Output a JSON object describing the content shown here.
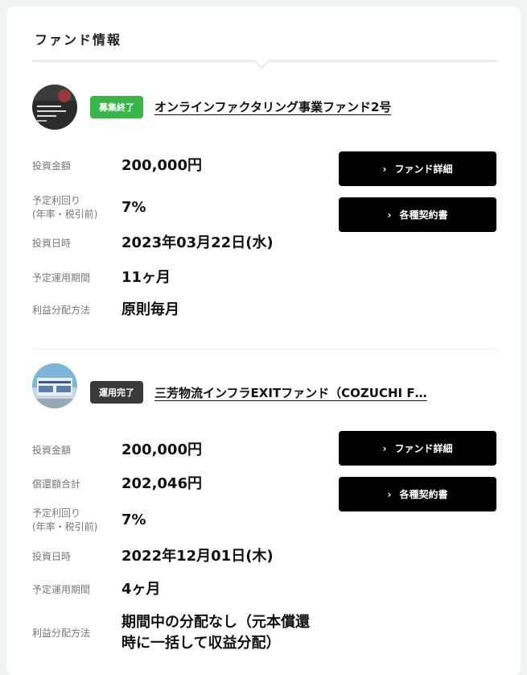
{
  "section_title": "ファンド情報",
  "funds": [
    {
      "status": "募集終了",
      "status_color": "#39b54a",
      "name": "オンラインファクタリング事業ファンド2号",
      "fields": [
        {
          "label": "投資金額",
          "value": "200,000円"
        },
        {
          "label": "予定利回り",
          "label2": "(年率・税引前)",
          "value": "7%"
        },
        {
          "label": "投資日時",
          "value": "2023年03月22日(水)"
        },
        {
          "label": "予定運用期間",
          "value": "11ヶ月"
        },
        {
          "label": "利益分配方法",
          "value": "原則毎月"
        }
      ],
      "buttons": {
        "detail": "ファンド詳細",
        "contracts": "各種契約書"
      }
    },
    {
      "status": "運用完了",
      "status_color": "#3a3a3a",
      "name": "三芳物流インフラEXITファンド（COZUCHI F…",
      "fields": [
        {
          "label": "投資金額",
          "value": "200,000円"
        },
        {
          "label": "償還額合計",
          "value": "202,046円"
        },
        {
          "label": "予定利回り",
          "label2": "(年率・税引前)",
          "value": "7%"
        },
        {
          "label": "投資日時",
          "value": "2022年12月01日(木)"
        },
        {
          "label": "予定運用期間",
          "value": "4ヶ月"
        },
        {
          "label": "利益分配方法",
          "value": "期間中の分配なし（元本償還",
          "value2": "時に一括して収益分配）"
        }
      ],
      "buttons": {
        "detail": "ファンド詳細",
        "contracts": "各種契約書"
      }
    }
  ],
  "icons": {
    "button_chevron": "chevron-right-icon"
  }
}
